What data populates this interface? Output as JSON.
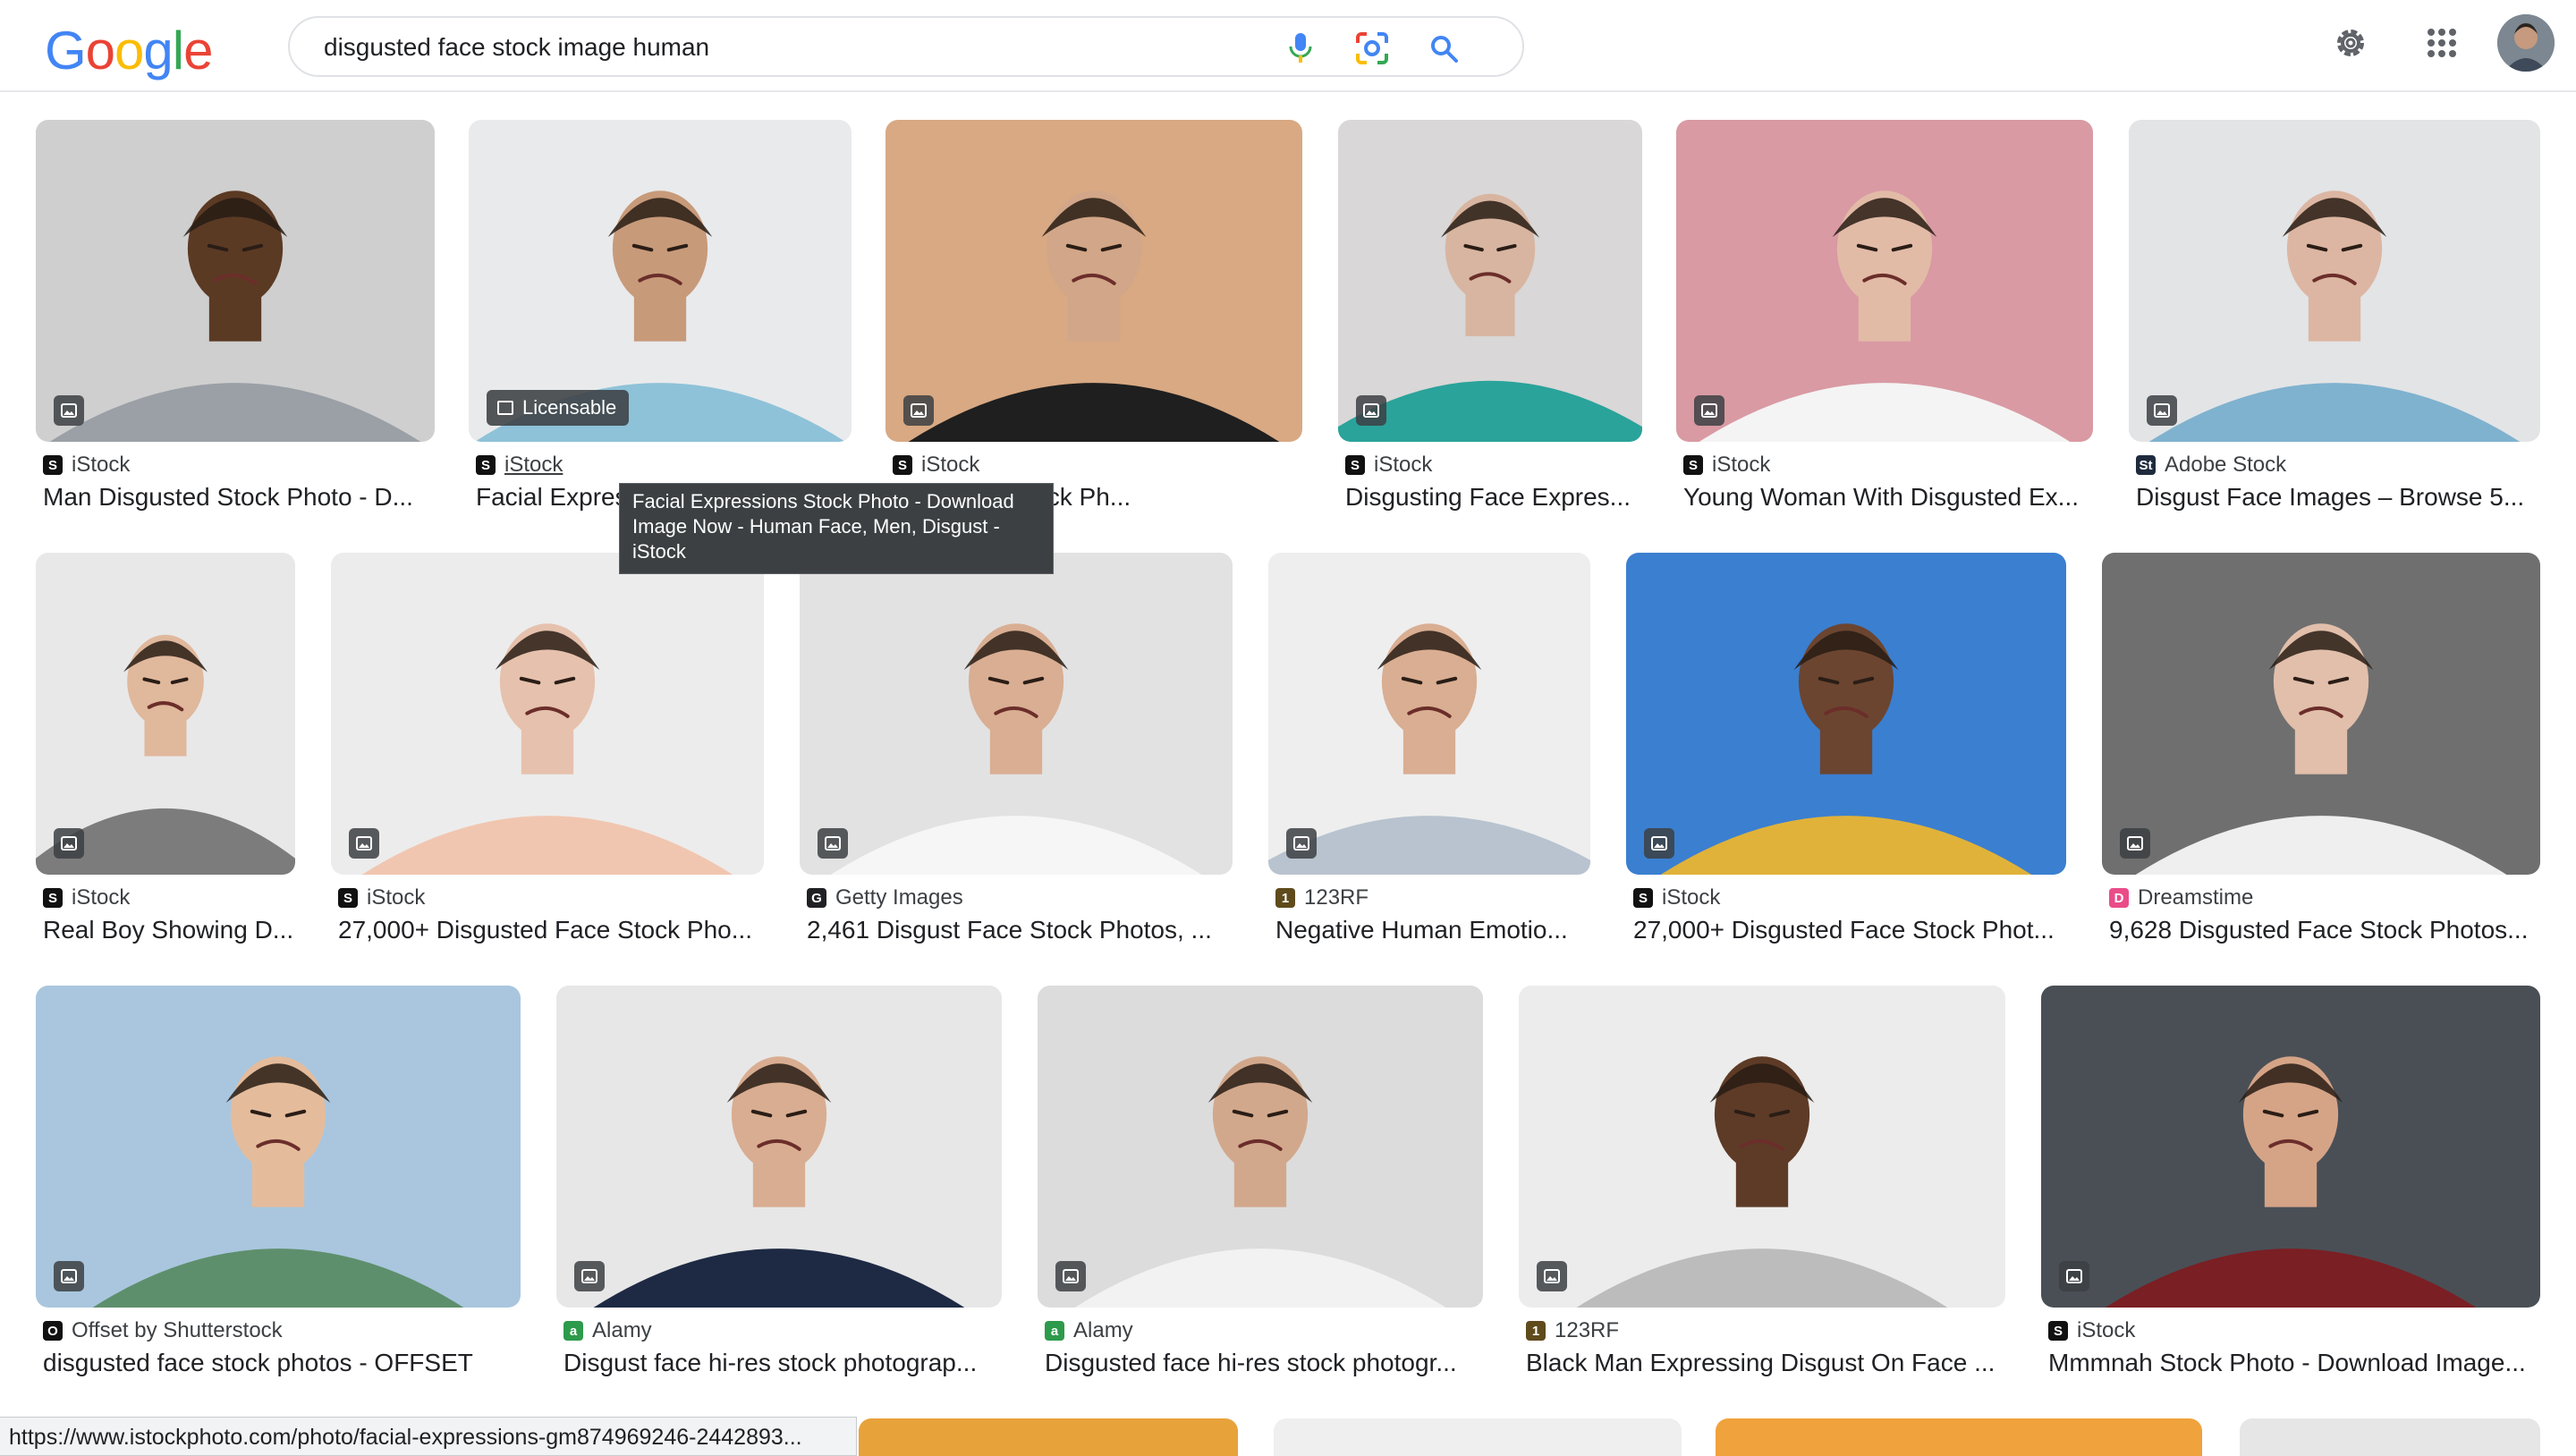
{
  "search": {
    "query": "disgusted face stock image human"
  },
  "logo": [
    "G",
    "o",
    "o",
    "g",
    "l",
    "e"
  ],
  "logo_colors": [
    "#4285F4",
    "#EA4335",
    "#FBBC05",
    "#4285F4",
    "#34A853",
    "#EA4335"
  ],
  "icons": {
    "mic": "mic-icon",
    "lens": "lens-icon",
    "search": "search-icon",
    "settings": "gear-icon",
    "apps": "apps-grid-icon",
    "avatar": "avatar"
  },
  "results": [
    {
      "source": "iStock",
      "title": "Man Disgusted Stock Photo - D...",
      "icon": "S",
      "icon_color": "#111111",
      "bg": "#cfcfcf",
      "skin": "#5b3a24",
      "shirt": "#9aa0a6"
    },
    {
      "source": "iStock",
      "title": "Facial Expres",
      "icon": "S",
      "icon_color": "#111111",
      "bg": "#e9eaec",
      "skin": "#c79a7a",
      "shirt": "#8ec2d8",
      "badge": "Licensable"
    },
    {
      "source": "iStock",
      "title": "sted Face Stock Ph...",
      "icon": "S",
      "icon_color": "#111111",
      "bg": "#d8a983",
      "skin": "#d2a688",
      "shirt": "#1f1f1f"
    },
    {
      "source": "iStock",
      "title": "Disgusting Face Expres...",
      "icon": "S",
      "icon_color": "#111111",
      "bg": "#d9d7d7",
      "skin": "#d8b5a0",
      "shirt": "#2aa39b"
    },
    {
      "source": "iStock",
      "title": "Young Woman With Disgusted Ex...",
      "icon": "S",
      "icon_color": "#111111",
      "bg": "#d99aa3",
      "skin": "#e2bba7",
      "shirt": "#f4f4f4"
    },
    {
      "source": "Adobe Stock",
      "title": "Disgust Face Images – Browse 5...",
      "icon": "St",
      "icon_color": "#1f2b3d",
      "bg": "#e3e4e6",
      "skin": "#dcb6a2",
      "shirt": "#7fb2cf"
    },
    {
      "source": "iStock",
      "title": "Real Boy Showing D...",
      "icon": "S",
      "icon_color": "#111111",
      "bg": "#e8e8e8",
      "skin": "#e0b89c",
      "shirt": "#7c7c7c"
    },
    {
      "source": "iStock",
      "title": "27,000+ Disgusted Face Stock Pho...",
      "icon": "S",
      "icon_color": "#111111",
      "bg": "#ececec",
      "skin": "#e6c1ad",
      "shirt": "#f1c6b0"
    },
    {
      "source": "Getty Images",
      "title": "2,461 Disgust Face Stock Photos, ...",
      "icon": "G",
      "icon_color": "#202124",
      "bg": "#e2e2e2",
      "skin": "#d9ae93",
      "shirt": "#f6f6f6"
    },
    {
      "source": "123RF",
      "title": "Negative Human Emotio...",
      "icon": "1",
      "icon_color": "#5f4b1c",
      "bg": "#eeeeee",
      "skin": "#d9ae92",
      "shirt": "#b8c3cf"
    },
    {
      "source": "iStock",
      "title": "27,000+ Disgusted Face Stock Phot...",
      "icon": "S",
      "icon_color": "#111111",
      "bg": "#3b7fd0",
      "skin": "#6b4530",
      "shirt": "#e0b23a"
    },
    {
      "source": "Dreamstime",
      "title": "9,628 Disgusted Face Stock Photos...",
      "icon": "D",
      "icon_color": "#ea4c89",
      "bg": "#6f6f6f",
      "skin": "#e2bfab",
      "shirt": "#efefef"
    },
    {
      "source": "Offset by Shutterstock",
      "title": "disgusted face stock photos - OFFSET",
      "icon": "O",
      "icon_color": "#111111",
      "bg": "#a9c6de",
      "skin": "#e4bc9c",
      "shirt": "#5e8f6c"
    },
    {
      "source": "Alamy",
      "title": "Disgust face hi-res stock photograp...",
      "icon": "a",
      "icon_color": "#2e9a4b",
      "bg": "#e7e7e7",
      "skin": "#d9ad91",
      "shirt": "#1e2a44"
    },
    {
      "source": "Alamy",
      "title": "Disgusted face hi-res stock photogr...",
      "icon": "a",
      "icon_color": "#2e9a4b",
      "bg": "#dcdcdc",
      "skin": "#d2a88c",
      "shirt": "#f2f2f2"
    },
    {
      "source": "123RF",
      "title": "Black Man Expressing Disgust On Face ...",
      "icon": "1",
      "icon_color": "#5f4b1c",
      "bg": "#ececec",
      "skin": "#5e3b27",
      "shirt": "#bcbcbc"
    },
    {
      "source": "iStock",
      "title": "Mmmnah Stock Photo - Download Image...",
      "icon": "S",
      "icon_color": "#111111",
      "bg": "#4a4f56",
      "skin": "#d5a487",
      "shirt": "#7a1f24"
    }
  ],
  "tooltip": "Facial Expressions Stock Photo - Download Image Now - Human Face, Men,  Disgust - iStock",
  "status_url": "https://www.istockphoto.com/photo/facial-expressions-gm874969246-2442893...",
  "partial_row_colors": [
    "#e8a23a",
    "#efefef",
    "#f0a23c",
    "#e6e6e6"
  ]
}
